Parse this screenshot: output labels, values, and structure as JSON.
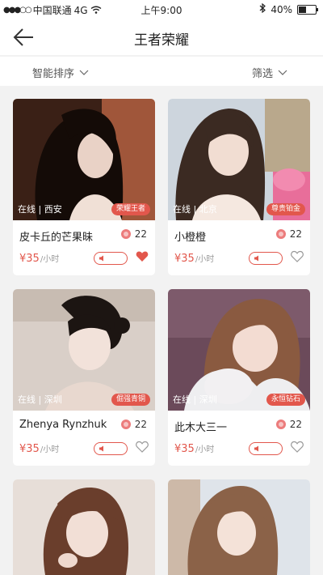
{
  "status": {
    "carrier": "中国联通",
    "network": "4G",
    "time": "上午9:00",
    "battery": "40%"
  },
  "nav": {
    "title": "王者荣耀"
  },
  "filters": {
    "sort_label": "智能排序",
    "filter_label": "筛选"
  },
  "unit": "/小时",
  "cards": [
    {
      "online": "在线 | 西安",
      "tier": "荣耀王者",
      "name": "皮卡丘的芒果昧",
      "likes": "22",
      "price": "¥35",
      "favorited": true
    },
    {
      "online": "在线 | 北京",
      "tier": "尊贵铂金",
      "name": "小橙橙",
      "likes": "22",
      "price": "¥35",
      "favorited": false
    },
    {
      "online": "在线 | 深圳",
      "tier": "倔强青铜",
      "name": "Zhenya Rynzhuk",
      "likes": "22",
      "price": "¥35",
      "favorited": false
    },
    {
      "online": "在线 | 深圳",
      "tier": "永恒钻石",
      "name": "此木大三一",
      "likes": "22",
      "price": "¥35",
      "favorited": false
    }
  ],
  "colors": {
    "accent": "#e2574c",
    "background": "#f2f2f2"
  }
}
